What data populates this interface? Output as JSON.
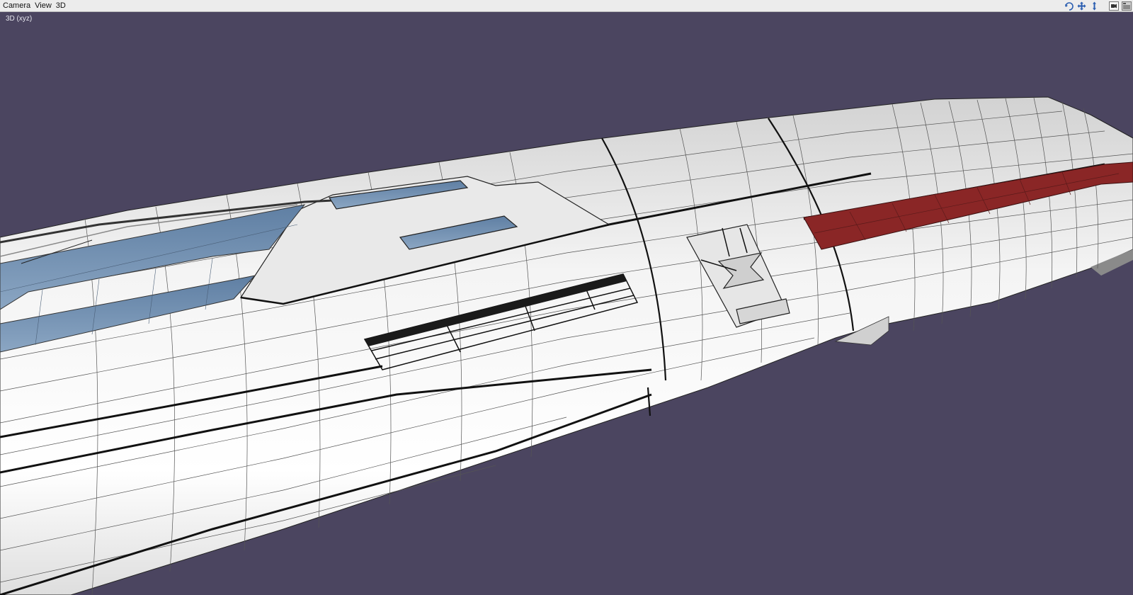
{
  "menu": {
    "items": [
      "Camera",
      "View",
      "3D"
    ]
  },
  "toolbar": {
    "icons": [
      "orbit-icon",
      "pan-icon",
      "dolly-icon",
      "camera-icon",
      "window-icon"
    ]
  },
  "viewport": {
    "label": "3D (xyz)",
    "background": "#4b4560"
  },
  "colors": {
    "hull": "#f2f2f2",
    "window": "#6f8fae",
    "red_stripe": "#8a2626",
    "menubar": "#ececec",
    "icon_blue": "#2a5db0"
  }
}
